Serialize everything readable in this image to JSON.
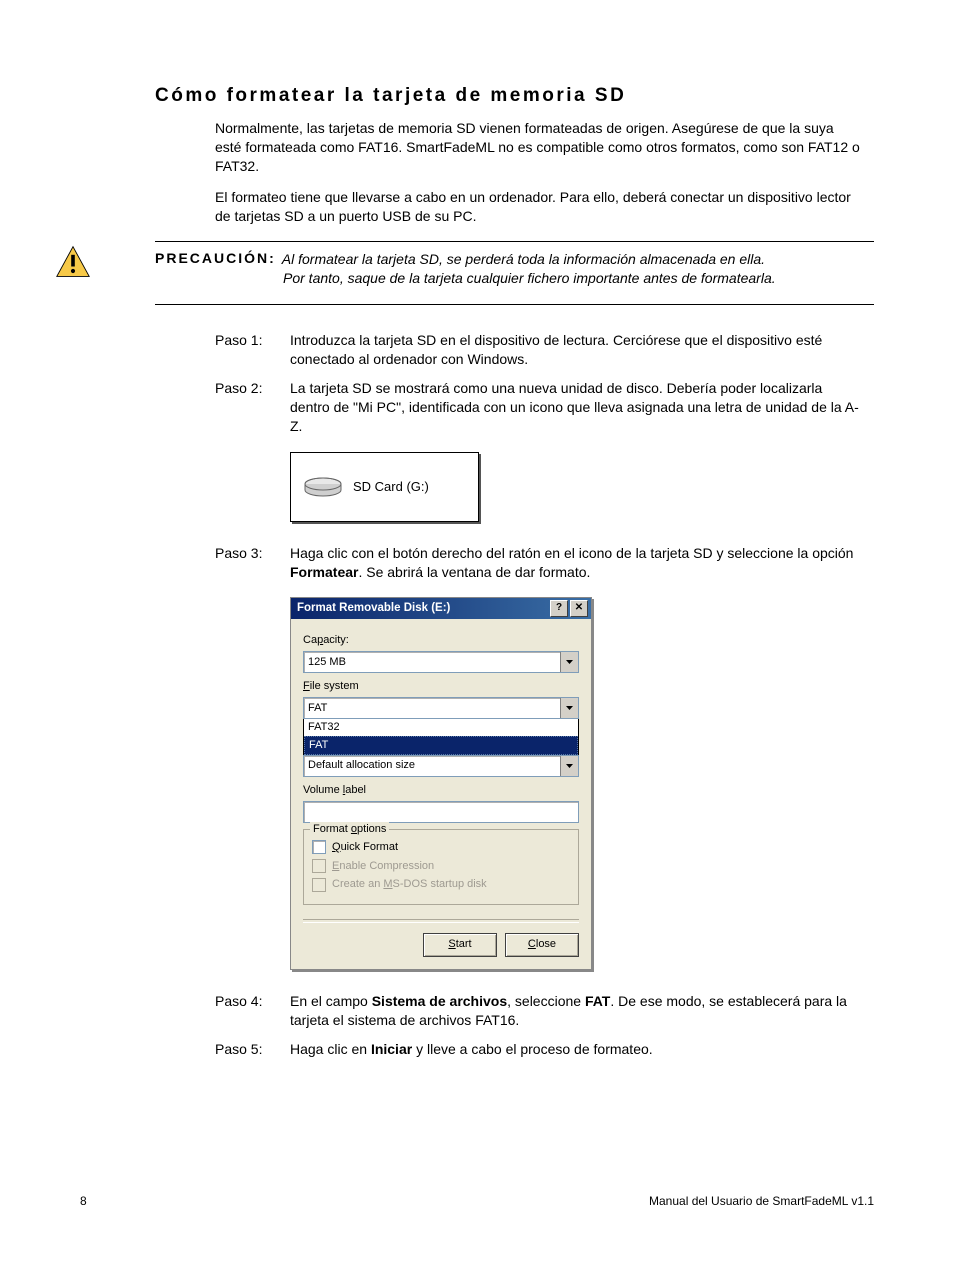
{
  "title": "Cómo formatear la tarjeta de memoria SD",
  "intro": {
    "p1": "Normalmente, las tarjetas de memoria SD vienen formateadas de origen. Asegúrese de que la suya esté formateada como FAT16. SmartFadeML no es compatible como otros formatos, como son FAT12 o FAT32.",
    "p2": "El formateo tiene que llevarse a cabo en un ordenador. Para ello, deberá conectar un dispositivo lector de tarjetas SD a un puerto USB de su PC."
  },
  "caution": {
    "label": "PRECAUCIÓN:",
    "line1": "Al formatear la tarjeta SD, se perderá toda la información almacenada en ella.",
    "line2": "Por tanto, saque de la tarjeta cualquier fichero importante antes de formatearla."
  },
  "steps": {
    "s1": {
      "label": "Paso 1:",
      "text": "Introduzca la tarjeta SD en el dispositivo de lectura. Cerciórese que el dispositivo esté conectado al ordenador con Windows."
    },
    "s2": {
      "label": "Paso 2:",
      "text": "La tarjeta SD se mostrará como una nueva unidad de disco. Debería poder localizarla dentro de \"Mi PC\", identificada con un icono que lleva asignada una letra de unidad de la A-Z."
    },
    "s3": {
      "label": "Paso 3:",
      "pre": "Haga clic con el botón derecho del ratón en el icono de la tarjeta SD y seleccione la opción ",
      "b": "Formatear",
      "post": ". Se abrirá la ventana de dar formato."
    },
    "s4": {
      "label": "Paso 4:",
      "pre": "En el campo ",
      "b1": "Sistema de archivos",
      "mid": ", seleccione ",
      "b2": "FAT",
      "post": ". De ese modo, se establecerá para la tarjeta el sistema de archivos FAT16."
    },
    "s5": {
      "label": "Paso 5:",
      "pre": "Haga clic en ",
      "b": "Iniciar",
      "post": " y lleve a cabo el proceso de formateo."
    }
  },
  "sdcard": {
    "label": "SD Card (G:)"
  },
  "dialog": {
    "title": "Format Removable Disk (E:)",
    "help": "?",
    "close": "✕",
    "capacity_label": "Capacity:",
    "capacity_value": "125 MB",
    "fs_label": "File system",
    "fs_value": "FAT",
    "fs_options": {
      "o1": "FAT32",
      "o2": "FAT"
    },
    "alloc_value": "Default allocation size",
    "vol_label": "Volume label",
    "group": "Format options",
    "opt_quick": "Quick Format",
    "opt_compress": "Enable Compression",
    "opt_msdos": "Create an MS-DOS startup disk",
    "btn_start": "Start",
    "btn_close": "Close"
  },
  "footer": {
    "page": "8",
    "doc": "Manual del Usuario de SmartFadeML v1.1"
  }
}
